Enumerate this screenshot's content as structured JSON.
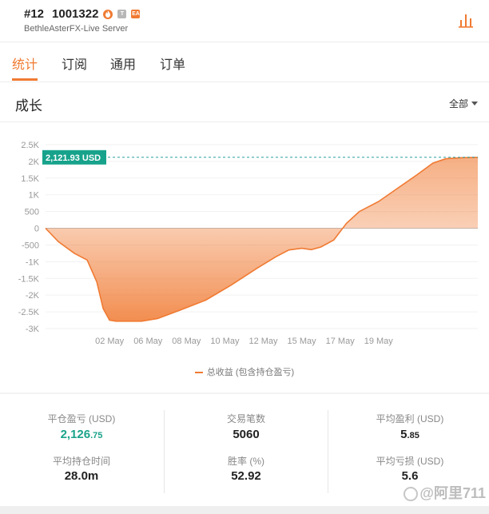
{
  "header": {
    "rank": "#12",
    "account_id": "1001322",
    "badges": {
      "flame": "flame-icon",
      "t": "T",
      "ea": "EA"
    },
    "server": "BethleAsterFX-Live Server",
    "chart_icon": "bar-chart-icon"
  },
  "tabs": [
    {
      "label": "统计",
      "active": true
    },
    {
      "label": "订阅",
      "active": false
    },
    {
      "label": "通用",
      "active": false
    },
    {
      "label": "订单",
      "active": false
    }
  ],
  "section": {
    "title": "成长",
    "filter_label": "全部"
  },
  "chart_data": {
    "type": "area",
    "y_ticks": [
      "2.5K",
      "2K",
      "1.5K",
      "1K",
      "500",
      "0",
      "-500",
      "-1K",
      "-1.5K",
      "-2K",
      "-2.5K",
      "-3K"
    ],
    "x_ticks": [
      "02 May",
      "06 May",
      "08 May",
      "10 May",
      "12 May",
      "15 May",
      "17 May",
      "19 May"
    ],
    "ylim": [
      -3000,
      2500
    ],
    "current_value_label": "2,121.93 USD",
    "current_value": 2121.93,
    "series": [
      {
        "name": "总收益 (包含持仓盈亏)",
        "color": "#f07a32",
        "points": [
          [
            0.0,
            0
          ],
          [
            0.04,
            -400
          ],
          [
            0.09,
            -750
          ],
          [
            0.13,
            -950
          ],
          [
            0.16,
            -1600
          ],
          [
            0.18,
            -2400
          ],
          [
            0.2,
            -2750
          ],
          [
            0.22,
            -2780
          ],
          [
            0.3,
            -2780
          ],
          [
            0.35,
            -2700
          ],
          [
            0.42,
            -2450
          ],
          [
            0.5,
            -2150
          ],
          [
            0.58,
            -1700
          ],
          [
            0.66,
            -1200
          ],
          [
            0.72,
            -850
          ],
          [
            0.76,
            -650
          ],
          [
            0.8,
            -600
          ],
          [
            0.83,
            -640
          ],
          [
            0.86,
            -560
          ],
          [
            0.9,
            -350
          ],
          [
            0.94,
            150
          ],
          [
            0.98,
            500
          ],
          [
            1.04,
            800
          ],
          [
            1.1,
            1200
          ],
          [
            1.16,
            1600
          ],
          [
            1.21,
            1950
          ],
          [
            1.25,
            2080
          ],
          [
            1.3,
            2110
          ],
          [
            1.35,
            2121.93
          ]
        ]
      }
    ],
    "x_tick_positions": [
      0.2,
      0.32,
      0.44,
      0.56,
      0.68,
      0.8,
      0.92,
      1.04
    ],
    "legend": "总收益 (包含持仓盈亏)"
  },
  "stats": {
    "col1": {
      "label1": "平仓盈亏 (USD)",
      "value1_main": "2,126",
      "value1_dec": ".75",
      "label2": "平均持仓时间",
      "value2": "28.0m"
    },
    "col2": {
      "label1": "交易笔数",
      "value1": "5060",
      "label2": "胜率 (%)",
      "value2": "52.92"
    },
    "col3": {
      "label1": "平均盈利 (USD)",
      "value1_main": "5",
      "value1_dec": ".85",
      "label2": "平均亏损 (USD)",
      "value2": "5.6"
    }
  },
  "watermark": "@阿里711"
}
